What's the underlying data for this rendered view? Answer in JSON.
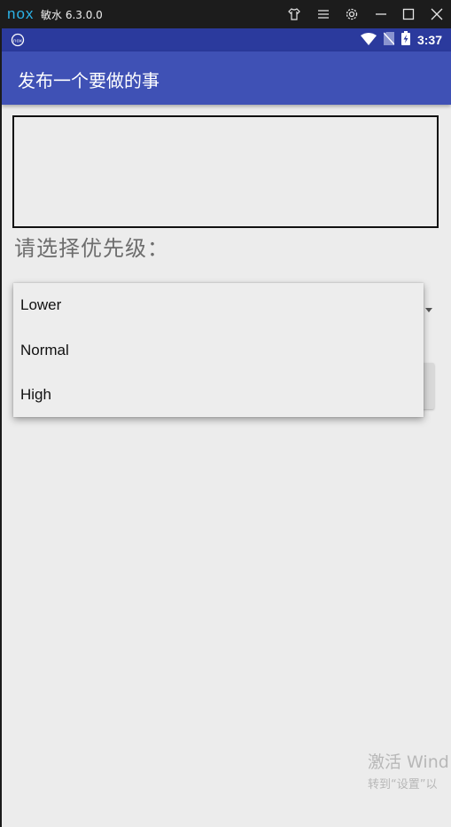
{
  "emulator": {
    "logo": "nox",
    "title": "敏水 6.3.0.0",
    "controls": [
      "shirt-icon",
      "menu-icon",
      "gear-icon",
      "minimize-icon",
      "maximize-icon",
      "close-icon"
    ]
  },
  "status_bar": {
    "time": "3:37",
    "icons": [
      "nox-status-icon",
      "wifi-icon",
      "no-sim-icon",
      "battery-charging-icon"
    ]
  },
  "app_bar": {
    "title": "发布一个要做的事"
  },
  "form": {
    "text_input_value": "",
    "priority_label": "请选择优先级：",
    "dropdown_options": [
      "Lower",
      "Normal",
      "High"
    ]
  },
  "watermark": {
    "line1": "激活 Wind",
    "line2": "转到“设置”以"
  },
  "colors": {
    "status_bar": "#2b3a9d",
    "app_bar": "#3f51b5",
    "background": "#ececec"
  }
}
